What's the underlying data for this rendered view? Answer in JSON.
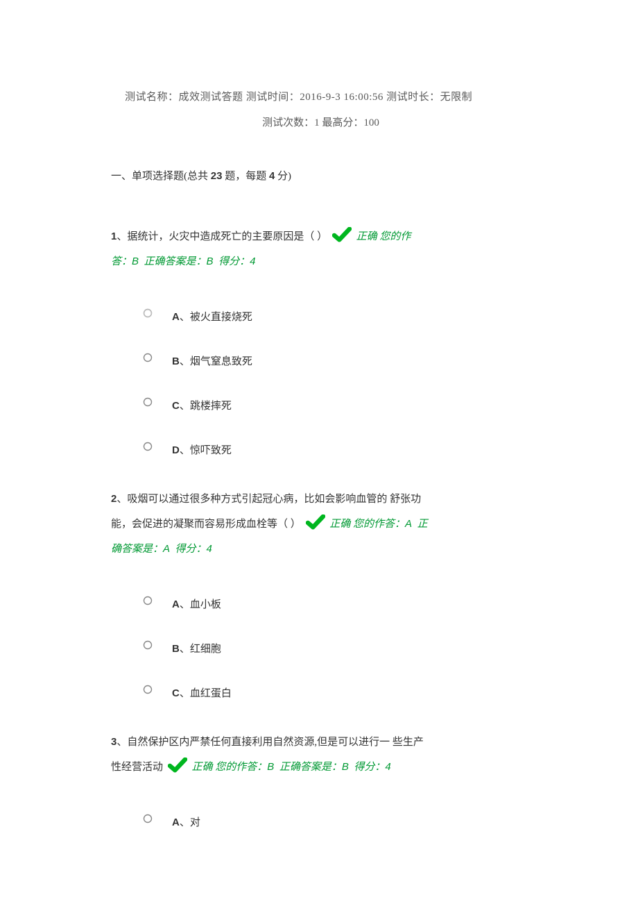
{
  "header": {
    "name_label": "测试名称：",
    "name_value": "成效测试答题",
    "time_label": "测试时间：",
    "time_value": "2016-9-3 16:00:56",
    "duration_label": "测试时长：",
    "duration_value": "无限制",
    "count_label": "测试次数：",
    "count_value": "1",
    "max_label": "最高分：",
    "max_value": "100"
  },
  "section": {
    "prefix": "一、单项选择题(总共 ",
    "total": "23",
    "mid": " 题，每题 ",
    "points": "4",
    "suffix": " 分)"
  },
  "status_text": "正确",
  "your_answer_label": "您的作答：",
  "correct_answer_label": "正确答案是：",
  "score_label": "得分：",
  "questions": [
    {
      "num": "1",
      "text": "、据统计，火灾中造成死亡的主要原因是（ ）",
      "your_answer": "B",
      "correct_answer": "B",
      "score": "4",
      "options": [
        {
          "letter": "A",
          "text": "、被火直接烧死"
        },
        {
          "letter": "B",
          "text": "、烟气窒息致死"
        },
        {
          "letter": "C",
          "text": "、跳楼摔死"
        },
        {
          "letter": "D",
          "text": "、惊吓致死"
        }
      ]
    },
    {
      "num": "2",
      "text_a": "、吸烟可以通过很多种方式引起冠心病，比如会影响血管的",
      "text_b": "舒张功能，会促进的凝聚而容易形成血栓等（  ）",
      "your_answer": "A",
      "correct_answer": "A",
      "score": "4",
      "options": [
        {
          "letter": "A",
          "text": "、血小板"
        },
        {
          "letter": "B",
          "text": "、红细胞"
        },
        {
          "letter": "C",
          "text": "、血红蛋白"
        }
      ]
    },
    {
      "num": "3",
      "text_a": "、自然保护区内严禁任何直接利用自然资源,但是可以进行一",
      "text_b": "些生产性经营活动",
      "your_answer": "B",
      "correct_answer": "B",
      "score": "4",
      "options": [
        {
          "letter": "A",
          "text": "、对"
        }
      ]
    }
  ]
}
